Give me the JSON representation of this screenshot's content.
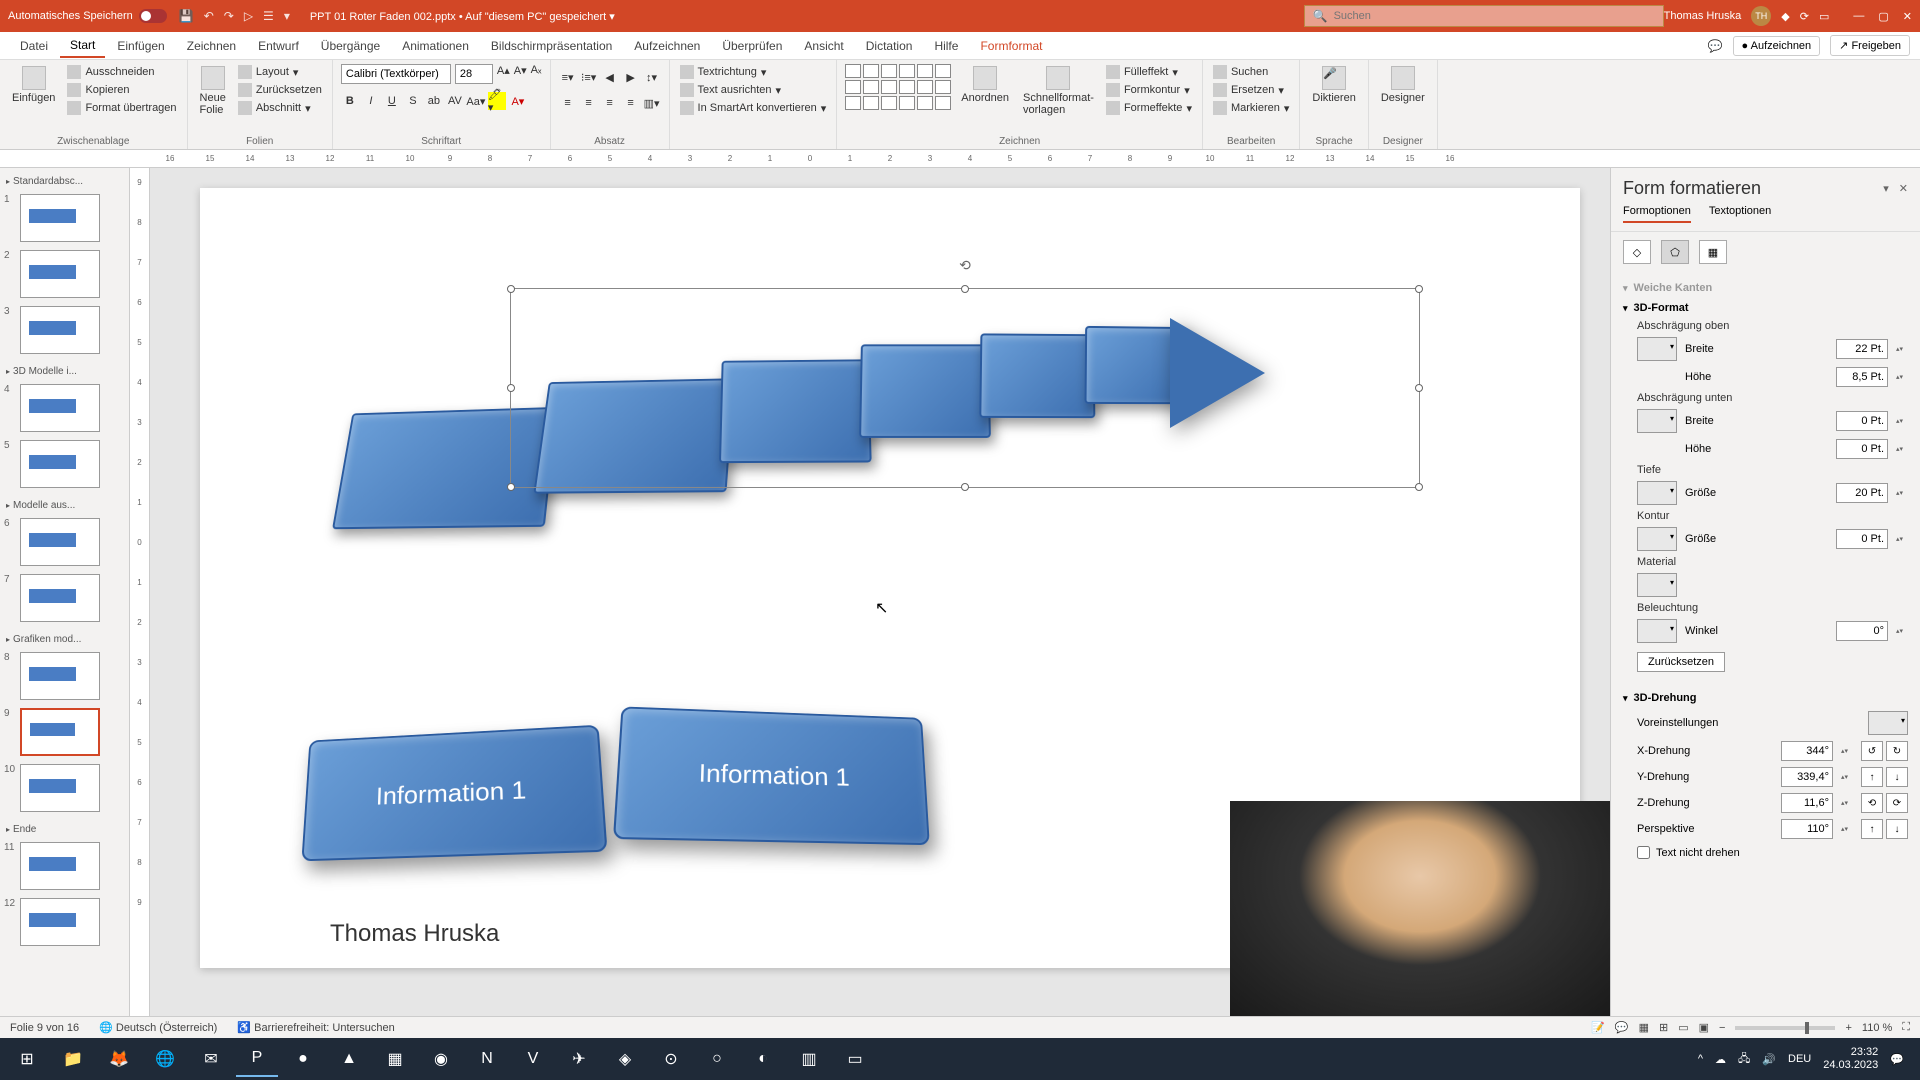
{
  "titlebar": {
    "autosave": "Automatisches Speichern",
    "docTitle": "PPT 01 Roter Faden 002.pptx • Auf \"diesem PC\" gespeichert ▾",
    "searchPlaceholder": "Suchen",
    "userName": "Thomas Hruska",
    "userInitials": "TH"
  },
  "tabs": {
    "file": "Datei",
    "home": "Start",
    "insert": "Einfügen",
    "draw": "Zeichnen",
    "design": "Entwurf",
    "transitions": "Übergänge",
    "animations": "Animationen",
    "slideshow": "Bildschirmpräsentation",
    "record": "Aufzeichnen",
    "review": "Überprüfen",
    "view": "Ansicht",
    "dictation": "Dictation",
    "help": "Hilfe",
    "format": "Formformat",
    "recordBtn": "Aufzeichnen",
    "shareBtn": "Freigeben"
  },
  "ribbon": {
    "paste": "Einfügen",
    "cut": "Ausschneiden",
    "copy": "Kopieren",
    "formatPainter": "Format übertragen",
    "clipboard": "Zwischenablage",
    "newSlide": "Neue\nFolie",
    "layout": "Layout",
    "reset": "Zurücksetzen",
    "section": "Abschnitt",
    "slides": "Folien",
    "fontName": "Calibri (Textkörper)",
    "fontSize": "28",
    "font": "Schriftart",
    "paragraph": "Absatz",
    "textDir": "Textrichtung",
    "alignText": "Text ausrichten",
    "smartArt": "In SmartArt konvertieren",
    "arrange": "Anordnen",
    "quickStyles": "Schnellformat-\nvorlagen",
    "fill": "Fülleffekt",
    "outline": "Formkontur",
    "effects": "Formeffekte",
    "drawing": "Zeichnen",
    "find": "Suchen",
    "replace": "Ersetzen",
    "select": "Markieren",
    "editing": "Bearbeiten",
    "dictate": "Diktieren",
    "voice": "Sprache",
    "designer": "Designer",
    "designerGrp": "Designer"
  },
  "thumbs": {
    "sec1": "Standardabsc...",
    "sec2": "3D Modelle i...",
    "sec3": "Modelle aus...",
    "sec4": "Grafiken mod...",
    "sec5": "Ende"
  },
  "slide": {
    "info1": "Information 1",
    "info2": "Information 1",
    "author": "Thomas Hruska"
  },
  "pane": {
    "title": "Form formatieren",
    "tabShape": "Formoptionen",
    "tabText": "Textoptionen",
    "softEdges": "Weiche Kanten",
    "fmt3d": "3D-Format",
    "bevelTop": "Abschrägung oben",
    "bevelBottom": "Abschrägung unten",
    "width": "Breite",
    "height": "Höhe",
    "bevelTopW": "22 Pt.",
    "bevelTopH": "8,5 Pt.",
    "bevelBotW": "0 Pt.",
    "bevelBotH": "0 Pt.",
    "depth": "Tiefe",
    "size": "Größe",
    "depthVal": "20 Pt.",
    "contour": "Kontur",
    "contourVal": "0 Pt.",
    "material": "Material",
    "lighting": "Beleuchtung",
    "angle": "Winkel",
    "angleVal": "0°",
    "resetBtn": "Zurücksetzen",
    "rot3d": "3D-Drehung",
    "presets": "Voreinstellungen",
    "xrot": "X-Drehung",
    "yrot": "Y-Drehung",
    "zrot": "Z-Drehung",
    "persp": "Perspektive",
    "xval": "344°",
    "yval": "339,4°",
    "zval": "11,6°",
    "pval": "110°",
    "keepFlat": "Text nicht drehen"
  },
  "status": {
    "slideNum": "Folie 9 von 16",
    "lang": "Deutsch (Österreich)",
    "access": "Barrierefreiheit: Untersuchen",
    "zoom": "110 %"
  },
  "tray": {
    "lang": "DEU",
    "time": "23:32",
    "date": "24.03.2023"
  },
  "ruler": [
    "16",
    "15",
    "14",
    "13",
    "12",
    "11",
    "10",
    "9",
    "8",
    "7",
    "6",
    "5",
    "4",
    "3",
    "2",
    "1",
    "0",
    "1",
    "2",
    "3",
    "4",
    "5",
    "6",
    "7",
    "8",
    "9",
    "10",
    "11",
    "12",
    "13",
    "14",
    "15",
    "16"
  ]
}
